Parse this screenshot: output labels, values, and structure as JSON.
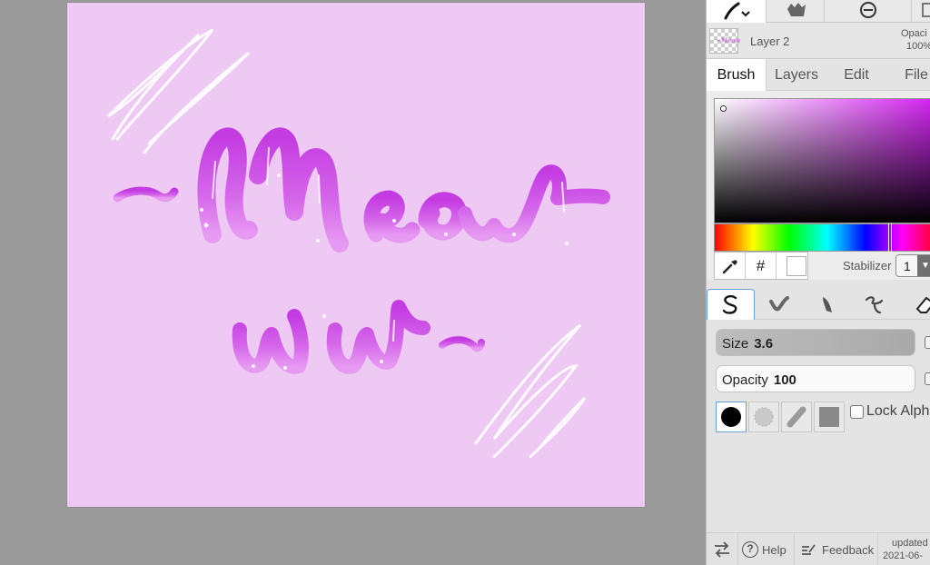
{
  "canvas": {
    "background": "#edc9f3",
    "artwork_text_line1": "~Meow",
    "artwork_text_line2": "ww~",
    "ink_color": "#c23ce0"
  },
  "toolbar": {
    "tools": [
      {
        "name": "brush-tool-icon"
      },
      {
        "name": "hand-tool-icon"
      },
      {
        "name": "zoom-out-icon"
      }
    ]
  },
  "layer": {
    "name": "Layer 2",
    "opacity_label": "Opaci",
    "opacity_value": "100%"
  },
  "tabs": {
    "brush": "Brush",
    "layers": "Layers",
    "edit": "Edit",
    "file": "File"
  },
  "color": {
    "hue": "#d21df0",
    "current": "#ffffff",
    "hex_label": "#"
  },
  "stabilizer": {
    "label": "Stabilizer",
    "value": "1",
    "arrow": "▼"
  },
  "brush_types": [
    "pen",
    "ink",
    "chalk",
    "fill",
    "eraser"
  ],
  "size": {
    "label": "Size",
    "value": "3.6"
  },
  "opacity": {
    "label": "Opacity",
    "value": "100"
  },
  "lock_alpha": {
    "label": "Lock Alpha",
    "checked": false
  },
  "footer": {
    "help": "Help",
    "feedback": "Feedback",
    "updated_line1": "updated",
    "updated_line2": "2021-06-"
  }
}
